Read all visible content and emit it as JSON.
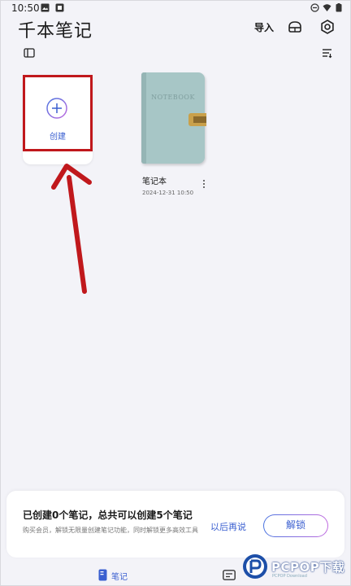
{
  "status_bar": {
    "time": "10:50"
  },
  "header": {
    "title": "千本笔记",
    "import_label": "导入"
  },
  "create_card": {
    "label": "创建"
  },
  "notebooks": [
    {
      "name": "笔记本",
      "date": "2024-12-31 10:50",
      "cover_title": "NOTEBOOK"
    }
  ],
  "banner": {
    "title": "已创建0个笔记，总共可以创建5个笔记",
    "subtitle": "购买会员，解锁无限量创建笔记功能，同时解锁更多高效工具",
    "later_label": "以后再说",
    "unlock_label": "解锁"
  },
  "bottom_nav": {
    "notes_label": "笔记"
  },
  "watermark": {
    "text": "PCPOP下载",
    "sub": "PCPOP Download"
  },
  "colors": {
    "accent": "#3a5fd0",
    "highlight": "#c0181c",
    "notebook_cover": "#a7c6c6",
    "background": "#f3f3f8"
  }
}
